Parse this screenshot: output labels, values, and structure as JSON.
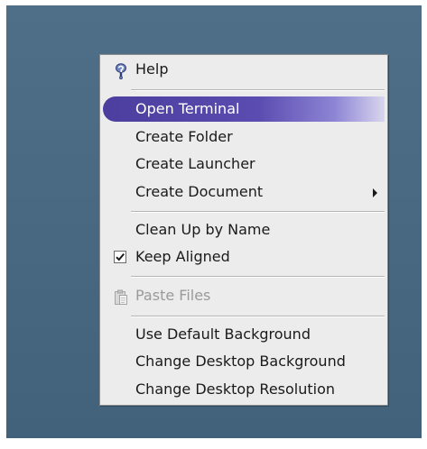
{
  "menu": {
    "help": {
      "icon": "help-icon",
      "label": "Help"
    },
    "open_terminal": "Open Terminal",
    "create_folder": "Create Folder",
    "create_launcher": "Create Launcher",
    "create_document": "Create Document",
    "clean_up": "Clean Up by Name",
    "keep_aligned": {
      "label": "Keep Aligned",
      "checked": true
    },
    "paste_files": {
      "icon": "paste-icon",
      "label": "Paste Files",
      "enabled": false
    },
    "use_default_background": "Use Default Background",
    "change_desktop_background": "Change Desktop Background",
    "change_desktop_resolution": "Change Desktop Resolution"
  },
  "colors": {
    "desktop": "#4f6f89",
    "menu_bg": "#ececec",
    "highlight": "#4c3e9e",
    "disabled_text": "#9a9a9a"
  }
}
